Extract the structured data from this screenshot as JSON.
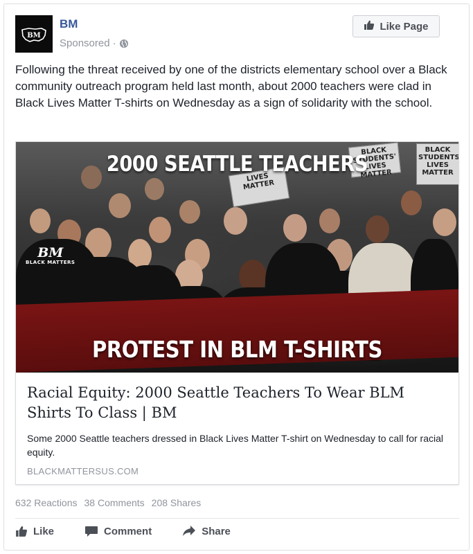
{
  "post": {
    "page_name": "BM",
    "sponsored_label": "Sponsored",
    "separator": "·",
    "like_page_label": "Like Page",
    "avatar_logo_text": "BM",
    "text": "Following the threat received by one of the districts elementary school over a Black community outreach program held last month, about 2000 teachers were clad in Black Lives Matter T-shirts on Wednesday as a sign of solidarity with the school."
  },
  "link_preview": {
    "image_overlay_top": "2000 SEATTLE TEACHERS",
    "image_overlay_bottom": "PROTEST IN BLM T-SHIRTS",
    "watermark_big": "BM",
    "watermark_small": "BLACK MATTERS",
    "sign_1": "BLACK STUDENTS' LIVES MATTER",
    "sign_2": "LIVES MATTER",
    "sign_3": "BLACK STUDENTS LIVES MATTER",
    "title": "Racial Equity: 2000 Seattle Teachers To Wear BLM Shirts To Class | BM",
    "description": "Some 2000 Seattle teachers dressed in Black Lives Matter T-shirt on Wednesday to call for racial equity.",
    "domain": "BLACKMATTERSUS.COM"
  },
  "stats": {
    "reactions": "632 Reactions",
    "comments": "38 Comments",
    "shares": "208 Shares"
  },
  "actions": {
    "like": "Like",
    "comment": "Comment",
    "share": "Share"
  },
  "colors": {
    "page_name": "#365899",
    "meta_gray": "#90949c",
    "button_text": "#4b4f56",
    "banner_red": "#6a1010"
  },
  "icons": [
    "globe-icon",
    "thumbs-up-icon",
    "comment-icon",
    "share-icon"
  ]
}
